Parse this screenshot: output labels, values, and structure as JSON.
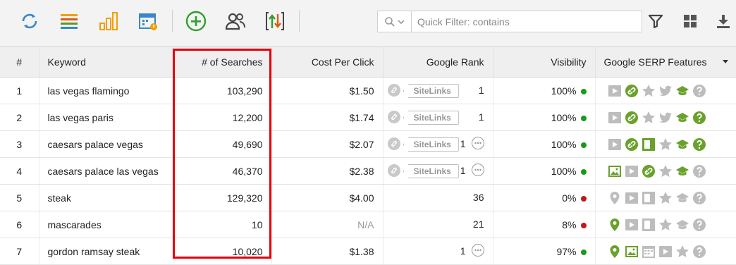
{
  "toolbar": {
    "icons": [
      "refresh-icon",
      "list-icon",
      "bar-chart-icon",
      "calendar-alert-icon",
      "add-circle-icon",
      "users-icon",
      "sort-arrows-icon",
      "filter-icon",
      "grid-view-icon",
      "download-icon"
    ],
    "quick_filter_placeholder": "Quick Filter: contains"
  },
  "colors": {
    "accent_blue": "#3b86c8",
    "green": "#2f9e2f",
    "orange": "#f0a000",
    "red": "#e8000a",
    "dot_green": "#1a9a1a",
    "dot_red": "#c0181b",
    "serp_green": "#6aa12c",
    "serp_grey": "#bdbdbd"
  },
  "table": {
    "columns": [
      "#",
      "Keyword",
      "# of Searches",
      "Cost Per Click",
      "Google Rank",
      "Visibility",
      "Google SERP Features"
    ],
    "rows": [
      {
        "num": "1",
        "keyword": "las vegas flamingo",
        "searches": "103,290",
        "cpc": "$1.50",
        "rank_sitelinks": "SiteLinks",
        "rank": "1",
        "visibility": "100%",
        "vis_status": "green",
        "serp": [
          [
            "video",
            "grey"
          ],
          [
            "link",
            "green"
          ],
          [
            "star",
            "grey"
          ],
          [
            "twitter",
            "grey"
          ],
          [
            "cap",
            "green"
          ],
          [
            "question",
            "grey"
          ]
        ]
      },
      {
        "num": "2",
        "keyword": "las vegas paris",
        "searches": "12,200",
        "cpc": "$1.74",
        "rank_sitelinks": "SiteLinks",
        "rank": "1",
        "visibility": "100%",
        "vis_status": "green",
        "serp": [
          [
            "video",
            "grey"
          ],
          [
            "link",
            "green"
          ],
          [
            "star",
            "grey"
          ],
          [
            "twitter",
            "grey"
          ],
          [
            "cap",
            "green"
          ],
          [
            "question",
            "green"
          ]
        ]
      },
      {
        "num": "3",
        "keyword": "caesars palace vegas",
        "searches": "49,690",
        "cpc": "$2.07",
        "rank_sitelinks": "SiteLinks",
        "rank": "1",
        "visibility": "100%",
        "vis_status": "green",
        "more": true,
        "serp": [
          [
            "video",
            "grey"
          ],
          [
            "link",
            "green"
          ],
          [
            "panel",
            "green"
          ],
          [
            "star",
            "grey"
          ],
          [
            "cap",
            "green"
          ],
          [
            "question",
            "green"
          ]
        ]
      },
      {
        "num": "4",
        "keyword": "caesars palace las vegas",
        "searches": "46,370",
        "cpc": "$2.38",
        "rank_sitelinks": "SiteLinks",
        "rank": "1",
        "visibility": "100%",
        "vis_status": "green",
        "more": true,
        "serp": [
          [
            "image",
            "green"
          ],
          [
            "video",
            "grey"
          ],
          [
            "link",
            "green"
          ],
          [
            "star",
            "grey"
          ],
          [
            "cap",
            "green"
          ],
          [
            "question",
            "grey"
          ]
        ]
      },
      {
        "num": "5",
        "keyword": "steak",
        "searches": "129,320",
        "cpc": "$4.00",
        "rank": "36",
        "visibility": "0%",
        "vis_status": "red",
        "serp": [
          [
            "pin",
            "grey"
          ],
          [
            "video",
            "grey"
          ],
          [
            "panel",
            "grey"
          ],
          [
            "star",
            "grey"
          ],
          [
            "cap",
            "grey"
          ],
          [
            "question",
            "grey"
          ]
        ]
      },
      {
        "num": "6",
        "keyword": "mascarades",
        "searches": "10",
        "cpc": "N/A",
        "rank": "21",
        "visibility": "8%",
        "vis_status": "red",
        "serp": [
          [
            "pin",
            "green"
          ],
          [
            "video",
            "grey"
          ],
          [
            "panel",
            "grey"
          ],
          [
            "star",
            "grey"
          ],
          [
            "cap",
            "grey"
          ],
          [
            "question",
            "grey"
          ]
        ]
      },
      {
        "num": "7",
        "keyword": "gordon ramsay steak",
        "searches": "10,020",
        "cpc": "$1.38",
        "rank": "1",
        "visibility": "97%",
        "vis_status": "green",
        "more": true,
        "serp": [
          [
            "pin",
            "green"
          ],
          [
            "image",
            "green"
          ],
          [
            "calendar",
            "grey"
          ],
          [
            "video",
            "grey"
          ],
          [
            "star",
            "grey"
          ],
          [
            "question",
            "grey"
          ]
        ]
      }
    ]
  }
}
